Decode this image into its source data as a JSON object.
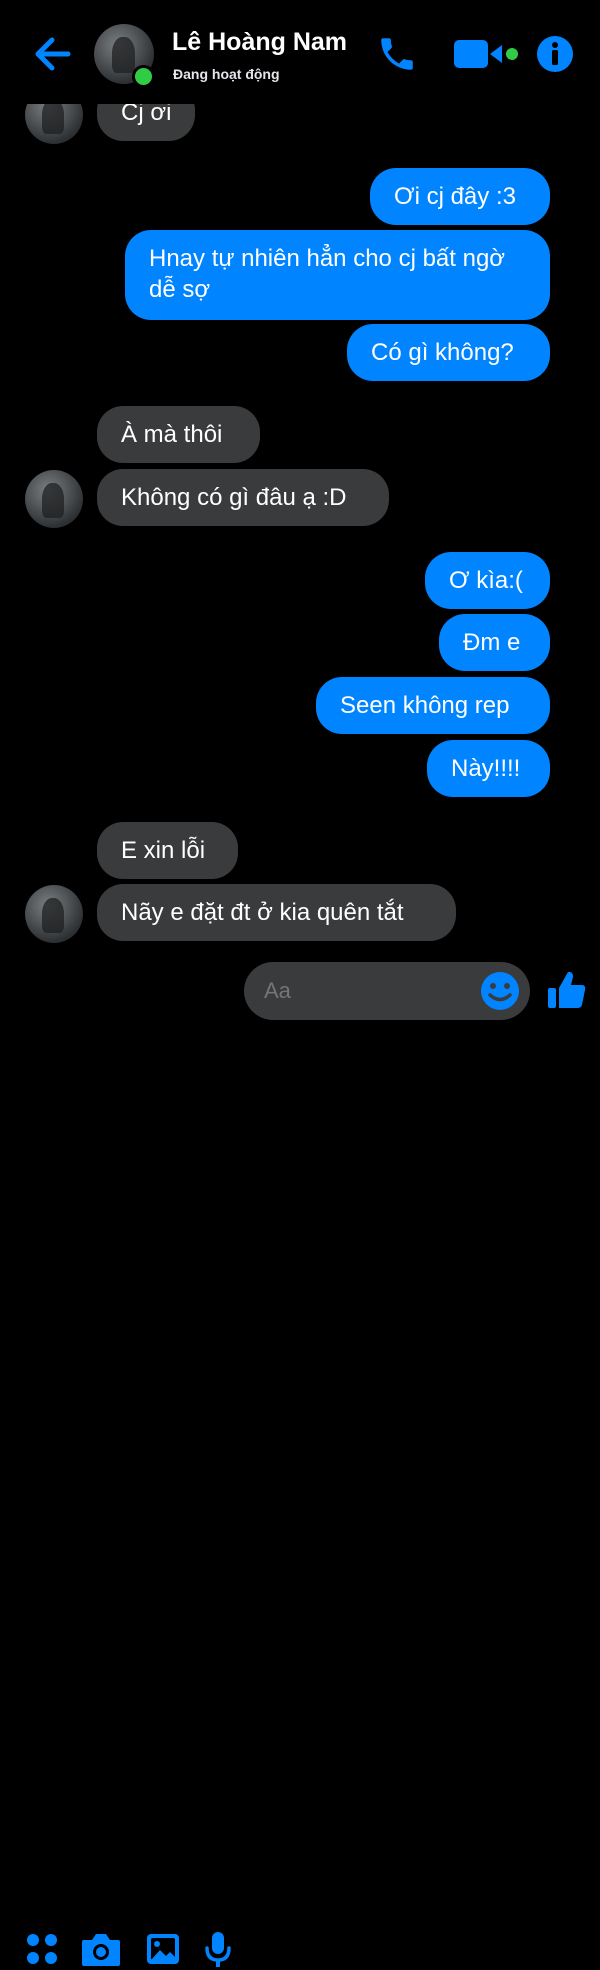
{
  "header": {
    "contact_name": "Lê Hoàng Nam",
    "status": "Đang hoạt động",
    "icons": [
      "back-arrow-icon",
      "phone-icon",
      "video-camera-icon",
      "info-icon"
    ]
  },
  "messages": [
    {
      "side": "received",
      "text": "Cj ơi"
    },
    {
      "side": "sent",
      "text": "Ơi cj đây :3"
    },
    {
      "side": "sent",
      "text": "Hnay tự nhiên  hẳn cho cj bất ngờ dễ sợ"
    },
    {
      "side": "sent",
      "text": "Có gì không?"
    },
    {
      "side": "received",
      "text": "À mà thôi"
    },
    {
      "side": "received",
      "text": "Không có gì đâu ạ :D"
    },
    {
      "side": "sent",
      "text": "Ơ kìa:("
    },
    {
      "side": "sent",
      "text": "Đm e"
    },
    {
      "side": "sent",
      "text": "Seen không rep"
    },
    {
      "side": "sent",
      "text": "Này!!!!"
    },
    {
      "side": "received",
      "text": "E xin lỗi"
    },
    {
      "side": "received",
      "text": "Nãy e đặt đt ở kia quên tắt"
    }
  ],
  "composer": {
    "placeholder": "Aa",
    "icons": [
      "apps-grid-icon",
      "camera-icon",
      "gallery-icon",
      "microphone-icon",
      "emoji-icon",
      "thumbs-up-icon"
    ]
  },
  "colors": {
    "accent": "#0084ff",
    "sent_bubble": "#0084ff",
    "received_bubble": "#3a3b3c",
    "background": "#000000",
    "online": "#31cc46"
  }
}
